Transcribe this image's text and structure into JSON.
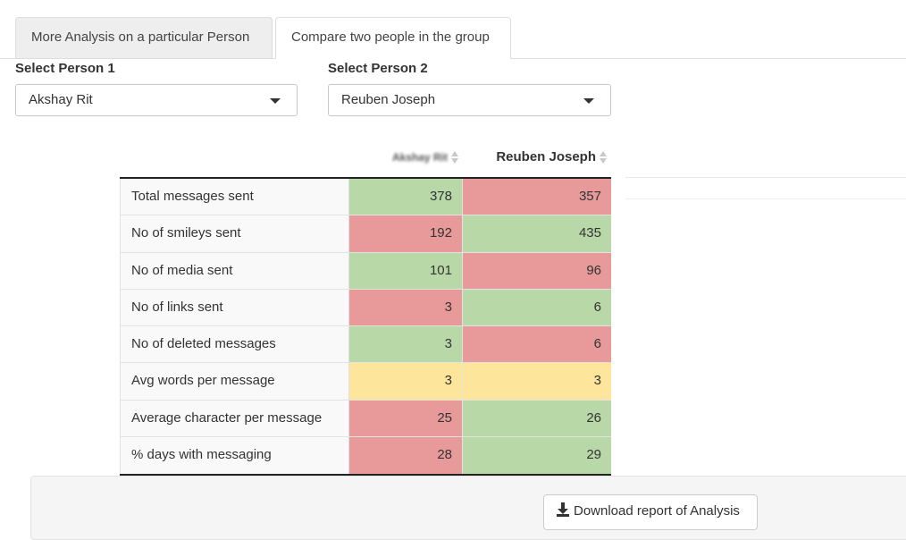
{
  "tabs": [
    {
      "label": "More Analysis on a particular Person",
      "active": false
    },
    {
      "label": "Compare two people in the group",
      "active": true
    }
  ],
  "selectors": {
    "person1": {
      "label": "Select Person 1",
      "value": "Akshay Rit"
    },
    "person2": {
      "label": "Select Person 2",
      "value": "Reuben Joseph"
    }
  },
  "table": {
    "headers": [
      "Akshay Rit",
      "Reuben Joseph"
    ],
    "rows": [
      {
        "metric": "Total messages sent",
        "p1": "378",
        "p2": "357",
        "p1_status": "higher",
        "p2_status": "lower"
      },
      {
        "metric": "No of smileys sent",
        "p1": "192",
        "p2": "435",
        "p1_status": "lower",
        "p2_status": "higher"
      },
      {
        "metric": "No of media sent",
        "p1": "101",
        "p2": "96",
        "p1_status": "higher",
        "p2_status": "lower"
      },
      {
        "metric": "No of links sent",
        "p1": "3",
        "p2": "6",
        "p1_status": "lower",
        "p2_status": "higher"
      },
      {
        "metric": "No of deleted messages",
        "p1": "3",
        "p2": "6",
        "p1_status": "higher",
        "p2_status": "lower"
      },
      {
        "metric": "Avg words per message",
        "p1": "3",
        "p2": "3",
        "p1_status": "equal",
        "p2_status": "equal"
      },
      {
        "metric": "Average character per message",
        "p1": "25",
        "p2": "26",
        "p1_status": "lower",
        "p2_status": "higher"
      },
      {
        "metric": "% days with messaging",
        "p1": "28",
        "p2": "29",
        "p1_status": "lower",
        "p2_status": "higher"
      }
    ]
  },
  "colors": {
    "higher": "#b8d8a8",
    "lower": "#e89a9a",
    "equal": "#fde69b"
  },
  "download": {
    "label": "Download report of Analysis",
    "icon": "download-icon"
  }
}
